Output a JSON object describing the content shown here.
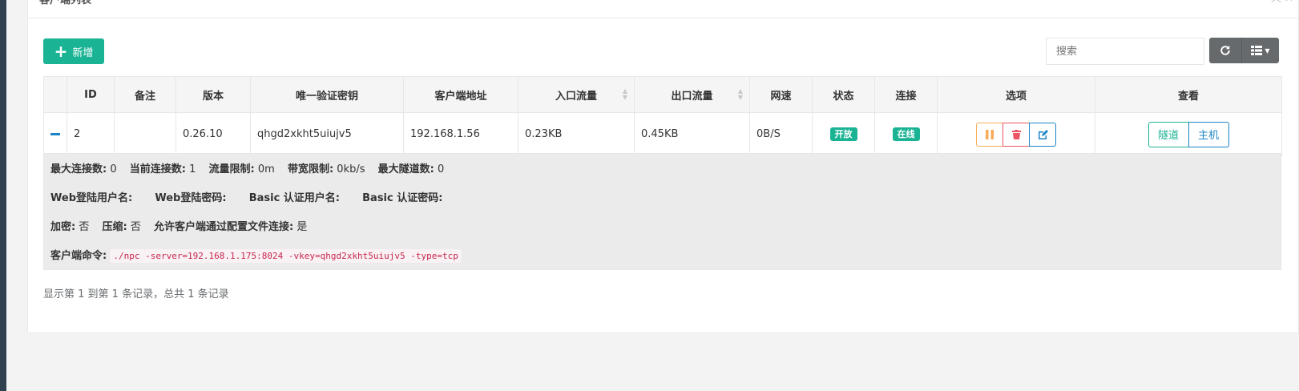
{
  "panel": {
    "title": "客户端列表"
  },
  "toolbar": {
    "add_label": "新增",
    "search_placeholder": "搜索"
  },
  "table": {
    "columns": [
      "",
      "ID",
      "备注",
      "版本",
      "唯一验证密钥",
      "客户端地址",
      "入口流量",
      "出口流量",
      "网速",
      "状态",
      "连接",
      "选项",
      "查看"
    ],
    "rows": [
      {
        "id": "2",
        "remark": "",
        "version": "0.26.10",
        "vkey": "qhgd2xkht5uiujv5",
        "address": "192.168.1.56",
        "inlet_flow": "0.23KB",
        "export_flow": "0.45KB",
        "rate": "0B/S",
        "status": "开放",
        "connect": "在线",
        "view_tunnel": "隧道",
        "view_host": "主机"
      }
    ]
  },
  "detail": {
    "max_conn_label": "最大连接数:",
    "max_conn_value": "0",
    "cur_conn_label": "当前连接数:",
    "cur_conn_value": "1",
    "flow_limit_label": "流量限制:",
    "flow_limit_value": "0m",
    "rate_limit_label": "带宽限制:",
    "rate_limit_value": "0kb/s",
    "max_tunnel_label": "最大隧道数:",
    "max_tunnel_value": "0",
    "web_user_label": "Web登陆用户名:",
    "web_pass_label": "Web登陆密码:",
    "basic_user_label": "Basic 认证用户名:",
    "basic_pass_label": "Basic 认证密码:",
    "encrypt_label": "加密:",
    "encrypt_value": "否",
    "compress_label": "压缩:",
    "compress_value": "否",
    "config_conn_label": "允许客户端通过配置文件连接:",
    "config_conn_value": "是",
    "cmd_label": "客户端命令:",
    "cmd_value": "./npc -server=192.168.1.175:8024 -vkey=qhgd2xkht5uiujv5 -type=tcp"
  },
  "pagination": {
    "info": "显示第 1 到第 1 条记录，总共 1 条记录"
  },
  "colors": {
    "primary": "#1ab394",
    "info": "#1c84c6",
    "warning": "#f8ac59",
    "danger": "#ed5565",
    "default": "#676a6c"
  },
  "icons": {
    "add": "plus-icon",
    "refresh": "refresh-icon",
    "columns": "columns-icon",
    "pause": "pause-icon",
    "delete": "trash-icon",
    "edit": "edit-icon",
    "collapse": "minus-icon"
  }
}
